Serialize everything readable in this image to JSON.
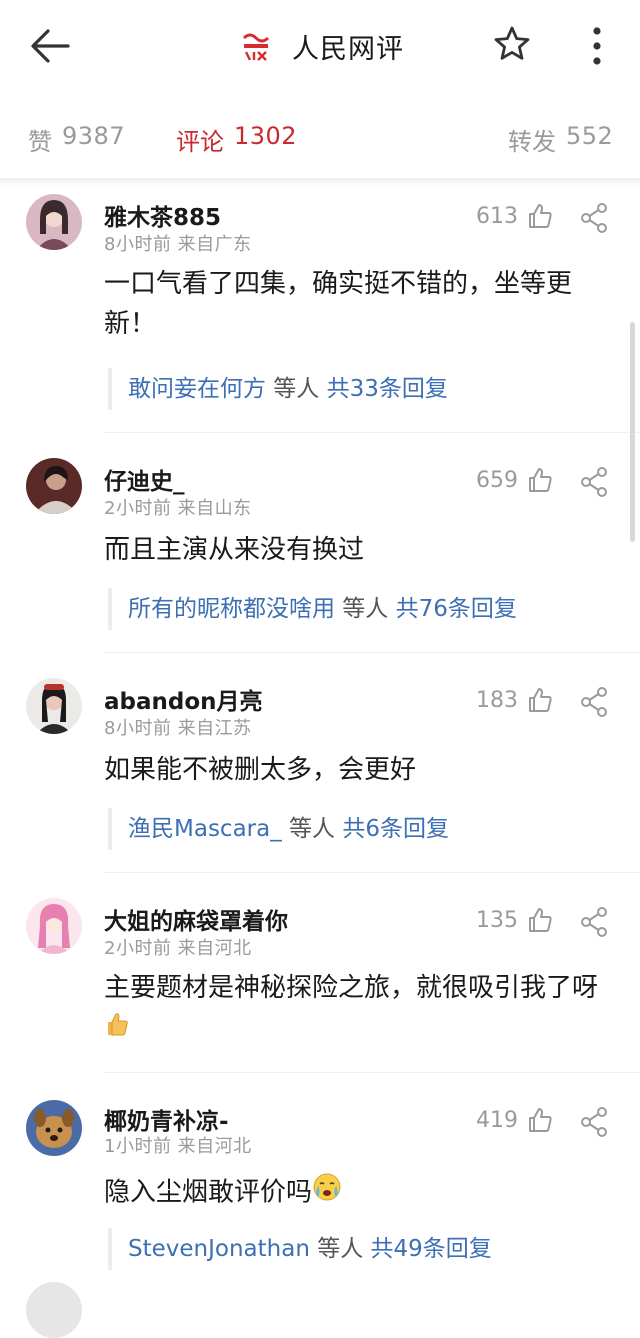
{
  "header": {
    "brand_name": "人民网评",
    "logo_text": "人民网评"
  },
  "stats": {
    "likes_label": "赞",
    "likes_count": "9387",
    "comments_label": "评论",
    "comments_count": "1302",
    "reposts_label": "转发",
    "reposts_count": "552"
  },
  "colors": {
    "accent": "#c8292e",
    "link": "#3d6fb5",
    "muted": "#9a9a9a"
  },
  "comments": [
    {
      "username": "雅木茶885",
      "meta": "8小时前  来自广东",
      "likes": "613",
      "text": "一口气看了四集，确实挺不错的，坐等更新！",
      "reply_user": "敢问妾在何方",
      "reply_mid": " 等人 ",
      "reply_count": "共33条回复"
    },
    {
      "username": "仔迪史_",
      "meta": "2小时前  来自山东",
      "likes": "659",
      "text": "而且主演从来没有换过",
      "reply_user": "所有的昵称都没啥用",
      "reply_mid": " 等人 ",
      "reply_count": "共76条回复"
    },
    {
      "username": "abandon月亮",
      "meta": "8小时前  来自江苏",
      "likes": "183",
      "text": "如果能不被删太多，会更好",
      "reply_user": "渔民Mascara_",
      "reply_mid": " 等人 ",
      "reply_count": "共6条回复"
    },
    {
      "username": "大姐的麻袋罩着你",
      "meta": "2小时前  来自河北",
      "likes": "135",
      "text": "主要题材是神秘探险之旅，就很吸引我了呀"
    },
    {
      "username": "椰奶青补凉-",
      "meta": "1小时前  来自河北",
      "likes": "419",
      "text": "隐入尘烟敢评价吗",
      "reply_user": "StevenJonathan",
      "reply_mid": " 等人 ",
      "reply_count": "共49条回复"
    }
  ],
  "icons": {
    "back": "arrow-left-icon",
    "favorite": "star-icon",
    "more": "more-vertical-icon",
    "like": "thumb-up-icon",
    "share": "share-icon",
    "emoji_thumb": "thumbs-up-emoji",
    "emoji_cry": "crying-emoji"
  }
}
